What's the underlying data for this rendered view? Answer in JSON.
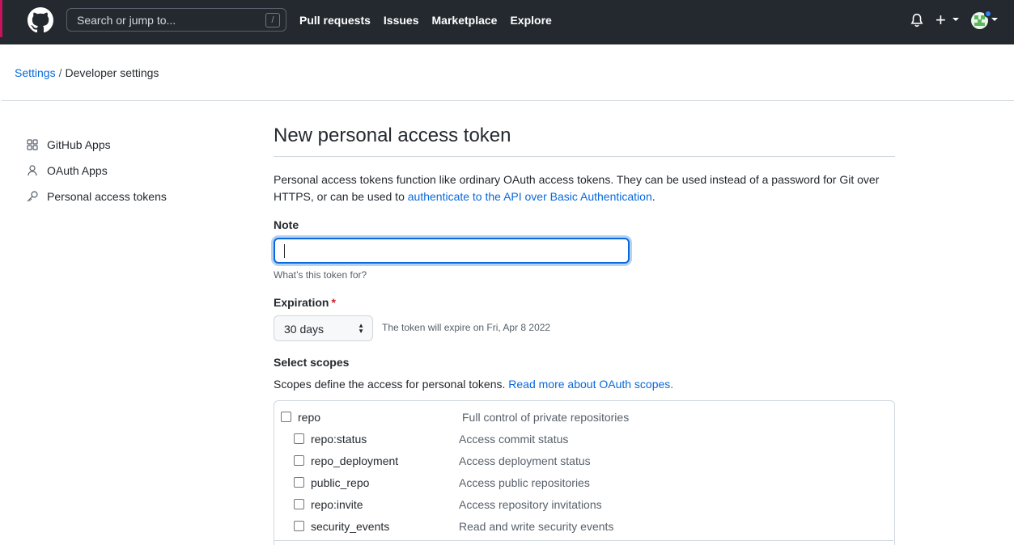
{
  "header": {
    "search_placeholder": "Search or jump to...",
    "search_key": "/",
    "nav": [
      "Pull requests",
      "Issues",
      "Marketplace",
      "Explore"
    ],
    "plus": "+",
    "icons": [
      "github-logo-icon",
      "bell-icon",
      "plus-icon",
      "chevron-down-icon",
      "avatar"
    ],
    "accent_color": "#c4125d"
  },
  "breadcrumb": {
    "root": "Settings",
    "separator": "/",
    "current": "Developer settings"
  },
  "sidebar": {
    "items": [
      {
        "label": "GitHub Apps",
        "icon": "apps-icon"
      },
      {
        "label": "OAuth Apps",
        "icon": "person-icon"
      },
      {
        "label": "Personal access tokens",
        "icon": "key-icon"
      }
    ]
  },
  "main": {
    "title": "New personal access token",
    "intro_text": "Personal access tokens function like ordinary OAuth access tokens. They can be used instead of a password for Git over HTTPS, or can be used to ",
    "intro_link": "authenticate to the API over Basic Authentication",
    "intro_end": ".",
    "note_label": "Note",
    "note_value": "",
    "note_hint": "What’s this token for?",
    "expiration_label": "Expiration",
    "required_mark": "*",
    "expiration_value": "30 days",
    "expiration_note": "The token will expire on Fri, Apr 8 2022",
    "scopes_label": "Select scopes",
    "scopes_desc": "Scopes define the access for personal tokens. ",
    "scopes_link": "Read more about OAuth scopes.",
    "scopes": [
      {
        "name": "repo",
        "desc": "Full control of private repositories",
        "checked": false
      },
      {
        "name": "repo:status",
        "desc": "Access commit status",
        "checked": false
      },
      {
        "name": "repo_deployment",
        "desc": "Access deployment status",
        "checked": false
      },
      {
        "name": "public_repo",
        "desc": "Access public repositories",
        "checked": false
      },
      {
        "name": "repo:invite",
        "desc": "Access repository invitations",
        "checked": false
      },
      {
        "name": "security_events",
        "desc": "Read and write security events",
        "checked": false
      }
    ]
  },
  "colors": {
    "header_bg": "#24292f",
    "link": "#0969da",
    "focus": "#0969da",
    "required": "#cf222e"
  }
}
